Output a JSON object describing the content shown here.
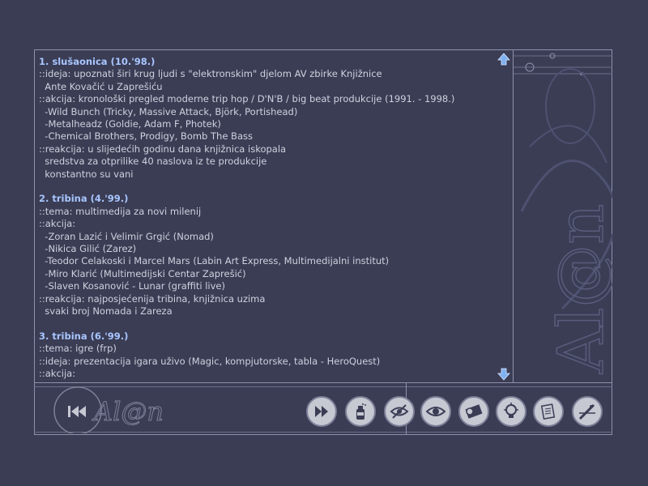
{
  "sections": [
    {
      "title": "1. slušaonica (10.'98.)",
      "lines": [
        "::ideja: upoznati širi krug ljudi s \"elektronskim\" djelom AV zbirke Knjižnice",
        "  Ante Kovačić u Zaprešiću",
        "::akcija: kronološki pregled moderne trip hop / D'N'B / big beat produkcije (1991. - 1998.)",
        "  -Wild Bunch (Tricky, Massive Attack, Björk, Portishead)",
        "  -Metalheadz (Goldie, Adam F, Photek)",
        "  -Chemical Brothers, Prodigy, Bomb The Bass",
        "::reakcija: u slijedećih godinu dana knjižnica iskopala",
        "  sredstva za otprilike 40 naslova iz te produkcije",
        "  konstantno su vani"
      ]
    },
    {
      "title": "2. tribina (4.'99.)",
      "lines": [
        "::tema: multimedija za novi milenij",
        "::akcija:",
        "  -Zoran Lazić i Velimir Grgić (Nomad)",
        "  -Nikica Gilić (Zarez)",
        "  -Teodor Celakoski i Marcel Mars (Labin Art Express, Multimedijalni institut)",
        "  -Miro Klarić (Multimedijski Centar Zaprešić)",
        "  -Slaven Kosanović - Lunar (graffiti live)",
        "::reakcija: najposjećenija tribina, knjižnica uzima",
        "  svaki broj Nomada i Zareza"
      ]
    },
    {
      "title": "3. tribina (6.'99.)",
      "lines": [
        "::tema: igre (frp)",
        "::ideja: prezentacija igara uživo (Magic, kompjutorske, tabla - HeroQuest)",
        "::akcija:"
      ]
    }
  ],
  "logo": {
    "text": "Al@n",
    "deco_text": "Al@n"
  },
  "toolbar": [
    {
      "name": "forward-button",
      "icon": "fast-forward-icon"
    },
    {
      "name": "spray-can-button",
      "icon": "spray-can-icon"
    },
    {
      "name": "crossed-eye-button",
      "icon": "crossed-eye-icon"
    },
    {
      "name": "eye-button",
      "icon": "eye-icon"
    },
    {
      "name": "film-button",
      "icon": "film-reel-icon"
    },
    {
      "name": "lightbulb-button",
      "icon": "lightbulb-icon"
    },
    {
      "name": "documents-button",
      "icon": "documents-icon"
    },
    {
      "name": "pen-button",
      "icon": "pen-icon"
    }
  ],
  "colors": {
    "background": "#3b3d55",
    "title": "#a8c6ff",
    "text": "#cfd1de",
    "border": "#8e91ab",
    "scroll_arrow": "#7fb0f0"
  }
}
